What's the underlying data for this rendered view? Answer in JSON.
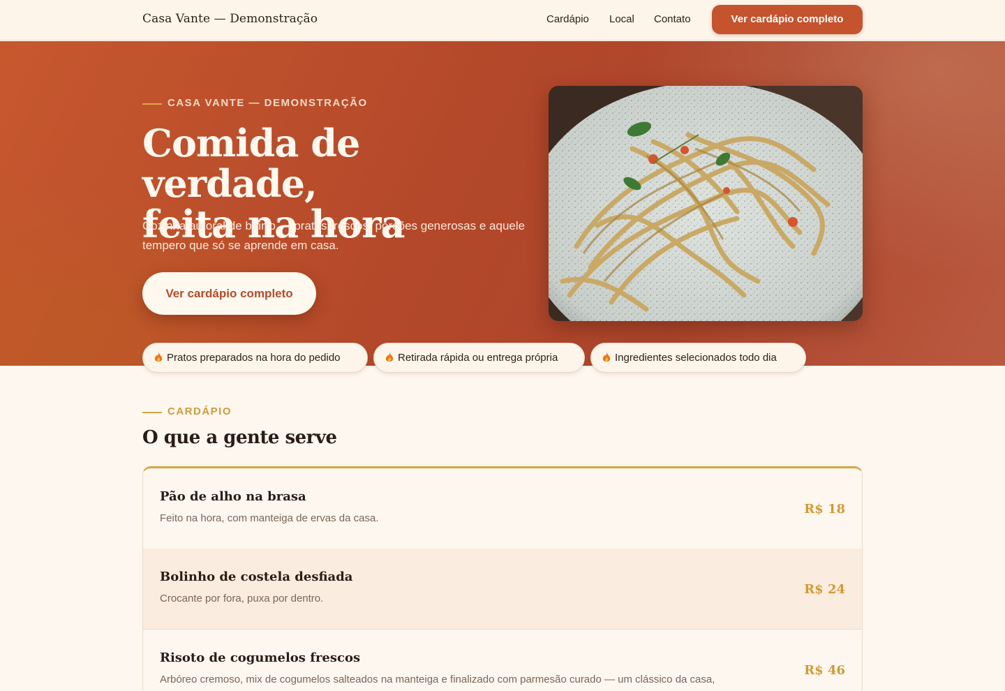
{
  "header": {
    "brand": "Casa Vante — Demonstração",
    "nav": [
      "Cardápio",
      "Local",
      "Contato"
    ],
    "cta": "Ver cardápio completo"
  },
  "hero": {
    "eyebrow": "CASA VANTE — DEMONSTRAÇÃO",
    "title_line1": "Comida de verdade,",
    "title_line2": "feita na hora",
    "subtitle": "Cozinha autoral de bairro — pratos frescos, porções generosas e aquele tempero que só se aprende em casa.",
    "cta": "Ver cardápio completo",
    "photo": "pasta-plate-photo"
  },
  "pills": [
    {
      "icon": "flame-icon",
      "label": "Pratos preparados na hora do pedido"
    },
    {
      "icon": "flame-icon",
      "label": "Retirada rápida ou entrega própria"
    },
    {
      "icon": "flame-icon",
      "label": "Ingredientes selecionados todo dia"
    }
  ],
  "menu": {
    "eyebrow": "CARDÁPIO",
    "title": "O que a gente serve",
    "items": [
      {
        "name": "Pão de alho na brasa",
        "desc": "Feito na hora, com manteiga de ervas da casa.",
        "price": "R$ 18"
      },
      {
        "name": "Bolinho de costela desfiada",
        "desc": "Crocante por fora, puxa por dentro.",
        "price": "R$ 24"
      },
      {
        "name": "Risoto de cogumelos frescos",
        "desc": "Arbóreo cremoso, mix de cogumelos salteados na manteiga e finalizado com parmesão curado — um clássico da casa,",
        "price": "R$ 46"
      }
    ]
  },
  "colors": {
    "accent": "#c4532e",
    "gold": "#d19a34",
    "background": "#fdf7ef"
  }
}
